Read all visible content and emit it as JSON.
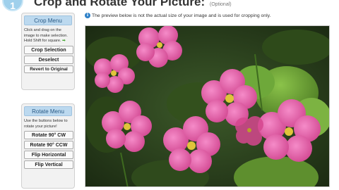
{
  "header": {
    "step_number": "1",
    "title": "Crop and Rotate Your Picture:",
    "optional_note": "(Optional)"
  },
  "crop_menu": {
    "title": "Crop Menu",
    "instructions_prefix": "Click and drag on the image to make selection. Hold Shift for square.",
    "buttons": {
      "crop_selection": "Crop Selection",
      "deselect": "Deselect",
      "revert": "Revert to Original"
    }
  },
  "rotate_menu": {
    "title": "Rotate Menu",
    "instructions": "Use the buttons below to rotate your picture!",
    "buttons": {
      "rotate_cw": "Rotate 90° CW",
      "rotate_ccw": "Rotate 90° CCW",
      "flip_horizontal": "Flip Horizontal",
      "flip_vertical": "Flip Vertical"
    }
  },
  "info": {
    "icon": "info-icon",
    "text": "The preview below is not the actual size of your image and is used for cropping only."
  },
  "colors": {
    "accent_blue": "#2d80c8",
    "panel_header": "#bcd9ef",
    "step_circle": "#9fd0ec"
  }
}
